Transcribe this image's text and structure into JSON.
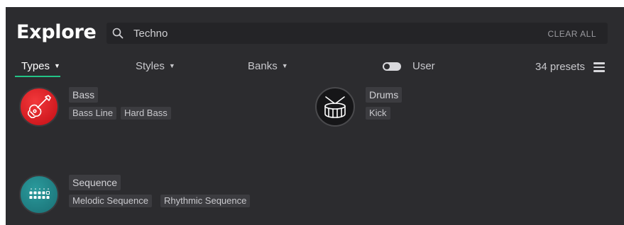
{
  "header": {
    "title": "Explore",
    "search": {
      "query": "Techno",
      "clear_label": "CLEAR ALL"
    }
  },
  "filters": {
    "types_label": "Types",
    "styles_label": "Styles",
    "banks_label": "Banks",
    "user_label": "User",
    "user_toggle_on": false,
    "presets_count": "34 presets"
  },
  "categories": [
    {
      "name": "Bass",
      "icon": "guitar-icon",
      "color": "#d81920",
      "subtypes": [
        "Bass Line",
        "Hard Bass"
      ]
    },
    {
      "name": "Drums",
      "icon": "drum-icon",
      "color": "#161618",
      "subtypes": [
        "Kick"
      ]
    },
    {
      "name": "Sequence",
      "icon": "sequencer-grid-icon",
      "color": "#1f8286",
      "subtypes": [
        "Melodic Sequence",
        "Rhythmic Sequence"
      ]
    }
  ],
  "colors": {
    "accent": "#23c487",
    "panel": "#2c2c2f"
  }
}
